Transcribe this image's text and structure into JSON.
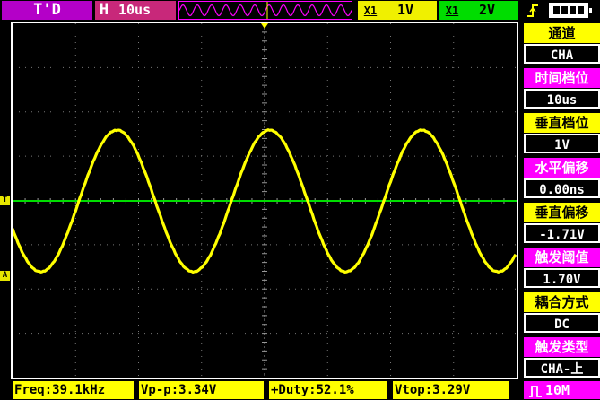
{
  "topbar": {
    "mode": "T'D",
    "timebase_label": "H",
    "timebase_value": "10us",
    "ch1_label": "X1",
    "ch1_value": "1V",
    "ch2_label": "X1",
    "ch2_value": "2V",
    "trigger_icon": "trigger-rising-edge-icon",
    "battery_icon": "battery-icon"
  },
  "markers": {
    "trigger_level": "T",
    "channel_a": "A"
  },
  "panel": [
    {
      "label": "通道",
      "value": "CHA"
    },
    {
      "label": "时间档位",
      "value": "10us"
    },
    {
      "label": "垂直档位",
      "value": "1V"
    },
    {
      "label": "水平偏移",
      "value": "0.00ns"
    },
    {
      "label": "垂直偏移",
      "value": "-1.71V"
    },
    {
      "label": "触发阈值",
      "value": "1.70V"
    },
    {
      "label": "耦合方式",
      "value": "DC"
    },
    {
      "label": "触发类型",
      "value": "CHA-上"
    }
  ],
  "measurements": {
    "freq": "Freq:39.1kHz",
    "vpp": "Vp-p:3.34V",
    "duty": "+Duty:52.1%",
    "vtop": "Vtop:3.29V"
  },
  "memory": {
    "icon": "pulse-icon",
    "depth": "10M"
  },
  "colors": {
    "trace": "#ffff00",
    "trigger_line": "#00dd00",
    "grid": "#777777"
  }
}
